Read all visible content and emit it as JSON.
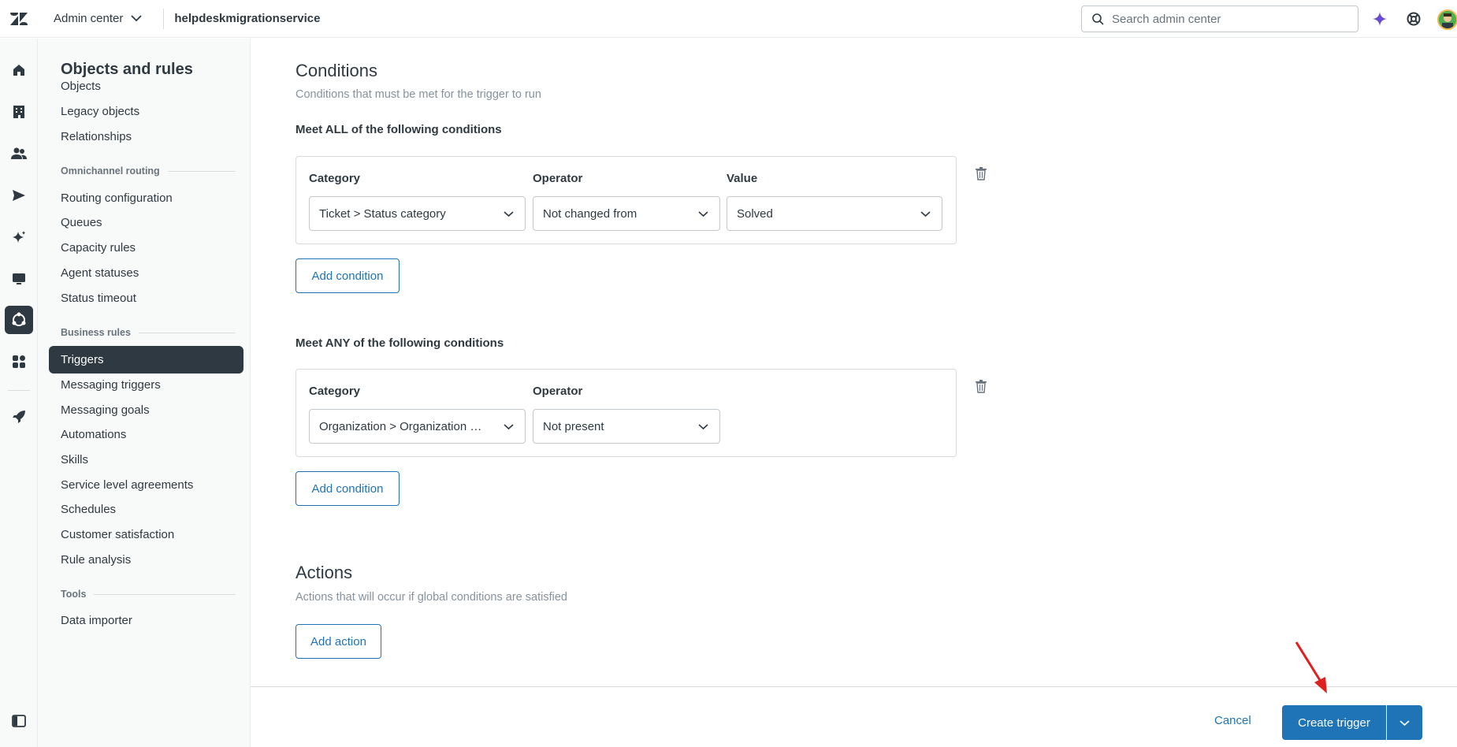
{
  "topbar": {
    "product": "Admin center",
    "subdomain": "helpdeskmigrationservice",
    "search_placeholder": "Search admin center"
  },
  "nav": {
    "title": "Objects and rules",
    "items_top": [
      "Objects",
      "Legacy objects",
      "Relationships"
    ],
    "group_omnichannel": "Omnichannel routing",
    "items_omnichannel": [
      "Routing configuration",
      "Queues",
      "Capacity rules",
      "Agent statuses",
      "Status timeout"
    ],
    "group_business": "Business rules",
    "active_item": "Triggers",
    "items_business": [
      "Messaging triggers",
      "Messaging goals",
      "Automations",
      "Skills",
      "Service level agreements",
      "Schedules",
      "Customer satisfaction",
      "Rule analysis"
    ],
    "group_tools": "Tools",
    "items_tools": [
      "Data importer"
    ]
  },
  "conditions": {
    "heading": "Conditions",
    "hint": "Conditions that must be met for the trigger to run",
    "all": {
      "label": "Meet ALL of the following conditions",
      "category_label": "Category",
      "operator_label": "Operator",
      "value_label": "Value",
      "category": "Ticket > Status category",
      "operator": "Not changed from",
      "value": "Solved",
      "add_label": "Add condition"
    },
    "any": {
      "label": "Meet ANY of the following conditions",
      "category_label": "Category",
      "operator_label": "Operator",
      "category": "Organization > Organization …",
      "operator": "Not present",
      "add_label": "Add condition"
    }
  },
  "actions": {
    "heading": "Actions",
    "hint": "Actions that will occur if global conditions are satisfied",
    "add_label": "Add action"
  },
  "footer": {
    "cancel": "Cancel",
    "create": "Create trigger"
  },
  "colors": {
    "accent": "#1f73b7",
    "dark": "#2f3941",
    "annotation_arrow": "#e02020"
  }
}
